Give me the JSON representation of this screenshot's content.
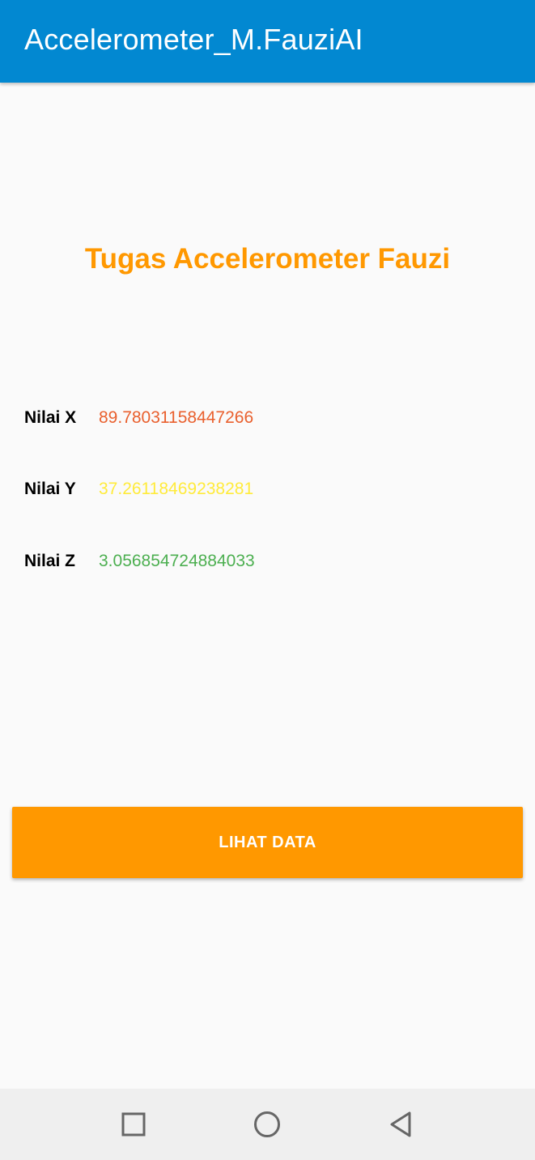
{
  "app_bar": {
    "title": "Accelerometer_M.FauziAI",
    "color": "#0288d1"
  },
  "heading": {
    "text": "Tugas Accelerometer Fauzi",
    "color": "#ff9800"
  },
  "readings": [
    {
      "label": "Nilai X",
      "value": "89.78031158447266",
      "color": "#e9602e"
    },
    {
      "label": "Nilai Y",
      "value": "37.26118469238281",
      "color": "#ffeb3b"
    },
    {
      "label": "Nilai Z",
      "value": "3.056854724884033",
      "color": "#4caf50"
    }
  ],
  "button": {
    "label": "LIHAT DATA",
    "color": "#ff9800"
  },
  "nav_bar": {
    "icons": [
      "recent-apps-icon",
      "home-icon",
      "back-icon"
    ]
  }
}
